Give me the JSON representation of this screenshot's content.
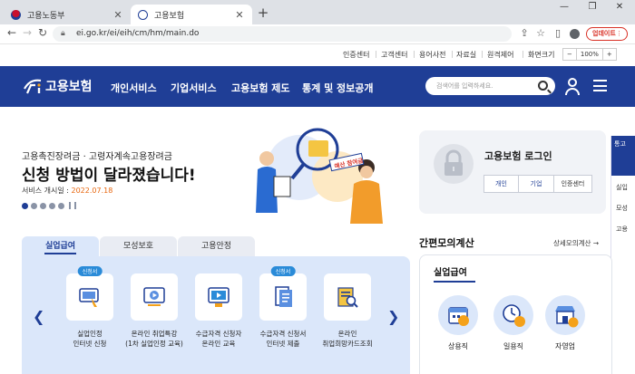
{
  "browser": {
    "tabs": [
      {
        "title": "고용노동부",
        "favicon_color": "#c8102e"
      },
      {
        "title": "고용보험",
        "favicon_color": "#1f3e96"
      }
    ],
    "url": "ei.go.kr/ei/eih/cm/hm/main.do",
    "update_label": "업데이트"
  },
  "utility": {
    "links": [
      "인증센터",
      "고객센터",
      "용어사전",
      "자료실",
      "원격제어",
      "화면크기"
    ],
    "zoom": {
      "minus": "−",
      "value": "100%",
      "plus": "+"
    }
  },
  "gnb": {
    "logo_text": "고용보험",
    "menus": [
      "개인서비스",
      "기업서비스",
      "고용보험 제도",
      "통계 및 정보공개"
    ],
    "search_placeholder": "검색어를 입력하세요.",
    "bg_color": "#1f3e96"
  },
  "hero": {
    "subtitle": "고용촉진장려금 · 고령자계속고용장려금",
    "title": "신청 방법이 달라졌습니다!",
    "date_label": "서비스 개시일 : ",
    "date_value": "2022.07.18",
    "sign_text": "예산 참여금",
    "slide_count": 5,
    "active_slide": 1
  },
  "login": {
    "title": "고용보험 로그인",
    "buttons": [
      "개인",
      "기업",
      "인증센터"
    ]
  },
  "side": {
    "top_text": "통고",
    "items": [
      "실입",
      "모성",
      "고용"
    ]
  },
  "service_tabs": {
    "tabs": [
      "실업급여",
      "모성보호",
      "고용안정"
    ],
    "active": 0
  },
  "services": [
    {
      "line1": "실업인정",
      "line2": "인터넷 신청",
      "badge": "신청서"
    },
    {
      "line1": "온라인 취업특강",
      "line2": "(1차 실업인정 교육)",
      "badge": ""
    },
    {
      "line1": "수급자격 신청자",
      "line2": "온라인 교육",
      "badge": ""
    },
    {
      "line1": "수급자격 신청서",
      "line2": "인터넷 제출",
      "badge": "신청서"
    },
    {
      "line1": "온라인",
      "line2": "취업희망카드조회",
      "badge": ""
    }
  ],
  "calculator": {
    "title": "간편모의계산",
    "more": "상세모의계산",
    "subtitle": "실업급여",
    "buttons": [
      "상용직",
      "일용직",
      "자영업"
    ]
  }
}
